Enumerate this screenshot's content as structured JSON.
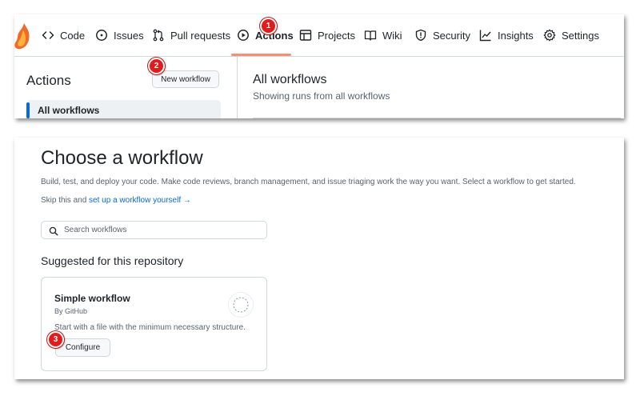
{
  "nav": {
    "items": [
      {
        "label": "Code",
        "icon": "code-icon"
      },
      {
        "label": "Issues",
        "icon": "issue-opened-icon"
      },
      {
        "label": "Pull requests",
        "icon": "git-pull-request-icon"
      },
      {
        "label": "Actions",
        "icon": "play-icon",
        "active": true
      },
      {
        "label": "Projects",
        "icon": "table-icon"
      },
      {
        "label": "Wiki",
        "icon": "book-icon"
      },
      {
        "label": "Security",
        "icon": "shield-icon"
      },
      {
        "label": "Insights",
        "icon": "graph-icon"
      },
      {
        "label": "Settings",
        "icon": "gear-icon"
      }
    ],
    "active_underline_color": "#fd8c73"
  },
  "sidebar": {
    "title": "Actions",
    "new_workflow_label": "New workflow",
    "items": [
      {
        "label": "All workflows",
        "selected": true
      }
    ]
  },
  "main": {
    "title": "All workflows",
    "subtitle": "Showing runs from all workflows"
  },
  "choose": {
    "title": "Choose a workflow",
    "description": "Build, test, and deploy your code. Make code reviews, branch management, and issue triaging work the way you want. Select a workflow to get started.",
    "skip_prefix": "Skip this and",
    "skip_link": "set up a workflow yourself",
    "skip_arrow": "→",
    "search_placeholder": "Search workflows",
    "suggested_heading": "Suggested for this repository",
    "card": {
      "title": "Simple workflow",
      "author": "By GitHub",
      "description": "Start with a file with the minimum necessary structure.",
      "configure_label": "Configure"
    }
  },
  "badges": [
    "1",
    "2",
    "3"
  ],
  "colors": {
    "accent_link": "#0969da",
    "badge": "#e21b1b",
    "border": "#d0d7de"
  }
}
